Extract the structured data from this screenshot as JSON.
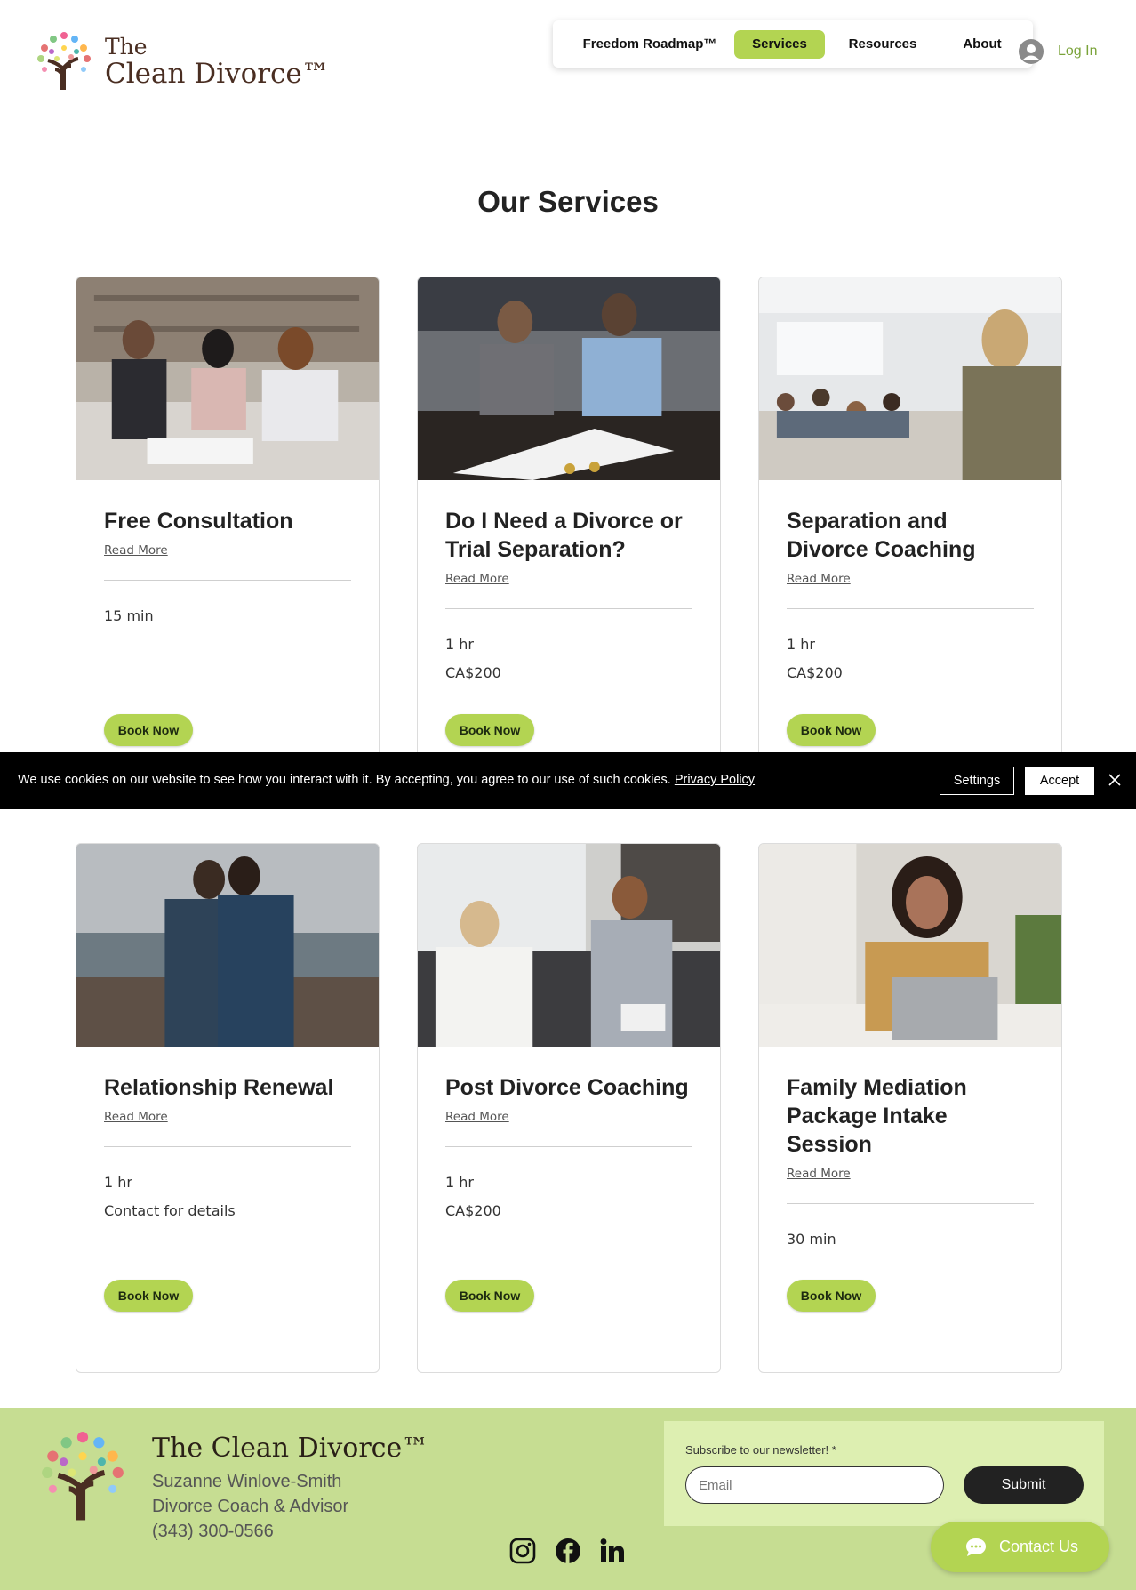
{
  "brand": {
    "line1": "The",
    "line2": "Clean Divorce™"
  },
  "nav": {
    "items": [
      {
        "label": "Freedom Roadmap™",
        "active": false
      },
      {
        "label": "Services",
        "active": true
      },
      {
        "label": "Resources",
        "active": false
      },
      {
        "label": "About",
        "active": false
      }
    ]
  },
  "login": {
    "label": "Log In"
  },
  "page": {
    "title": "Our Services"
  },
  "services": [
    {
      "title": "Free Consultation",
      "link": "Read More",
      "duration": "15 min",
      "price": "",
      "button": "Book Now",
      "image": "consultation-photo"
    },
    {
      "title": "Do I Need a Divorce or Trial Separation?",
      "link": "Read More",
      "duration": "1 hr",
      "price": "CA$200",
      "button": "Book Now",
      "image": "couple-at-table-photo"
    },
    {
      "title": "Separation and Divorce Coaching",
      "link": "Read More",
      "duration": "1 hr",
      "price": "CA$200",
      "button": "Book Now",
      "image": "classroom-coach-photo"
    },
    {
      "title": "Relationship Renewal",
      "link": "Read More",
      "duration": "1 hr",
      "price": "Contact for details",
      "button": "Book Now",
      "image": "couple-on-beach-photo"
    },
    {
      "title": "Post Divorce Coaching",
      "link": "Read More",
      "duration": "1 hr",
      "price": "CA$200",
      "button": "Book Now",
      "image": "comforting-client-photo"
    },
    {
      "title": "Family Mediation Package Intake Session",
      "link": "Read More",
      "duration": "30 min",
      "price": "",
      "button": "Book Now",
      "image": "smiling-woman-laptop-photo"
    }
  ],
  "cookie": {
    "text": "We use cookies on our website to see how you interact with it. By accepting, you agree to our use of such cookies.",
    "policy_link": "Privacy Policy",
    "settings_label": "Settings",
    "accept_label": "Accept"
  },
  "footer": {
    "brand": "The Clean Divorce™",
    "name": "Suzanne Winlove-Smith",
    "role": "Divorce Coach & Advisor",
    "phone": "(343) 300-0566",
    "newsletter": {
      "label": "Subscribe to our newsletter! *",
      "placeholder": "Email",
      "submit_label": "Submit"
    },
    "social": [
      "instagram-icon",
      "facebook-icon",
      "linkedin-icon"
    ],
    "contact_label": "Contact Us"
  },
  "colors": {
    "accent": "#b3d452",
    "footer_bg": "#c6dd92",
    "newsletter_bg": "#ddefb1",
    "login": "#7aa33a"
  }
}
